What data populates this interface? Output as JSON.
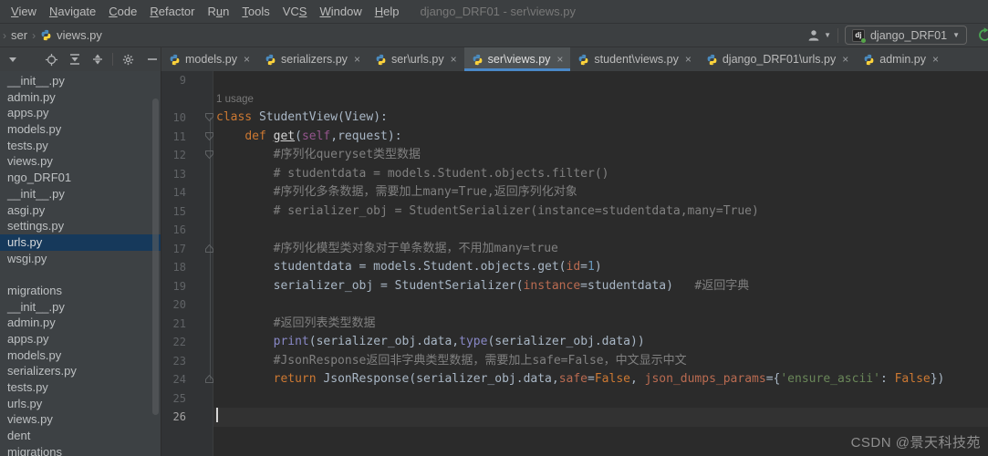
{
  "window": {
    "title": "django_DRF01 - ser\\views.py"
  },
  "menu": {
    "items": [
      {
        "label": "View",
        "u": 0
      },
      {
        "label": "Navigate",
        "u": 0
      },
      {
        "label": "Code",
        "u": 0
      },
      {
        "label": "Refactor",
        "u": 0
      },
      {
        "label": "Run",
        "u": 1
      },
      {
        "label": "Tools",
        "u": 0
      },
      {
        "label": "VCS",
        "u": 2
      },
      {
        "label": "Window",
        "u": 0
      },
      {
        "label": "Help",
        "u": 0
      }
    ]
  },
  "breadcrumb": {
    "items": [
      "ser",
      "views.py"
    ]
  },
  "header_right": {
    "run_config_label": "django_DRF01",
    "dj_abbrev": "dj"
  },
  "icons": {
    "chevron": "›",
    "dropdown": "▼",
    "close": "×",
    "minus": "—"
  },
  "project_panel": {
    "tools": [
      "view-options-dropdown",
      "locate-file",
      "expand-all",
      "collapse-all",
      "separator",
      "settings-gear",
      "hide-panel"
    ],
    "items": [
      "__init__.py",
      "admin.py",
      "apps.py",
      "models.py",
      "tests.py",
      "views.py",
      "ngo_DRF01",
      "__init__.py",
      "asgi.py",
      "settings.py",
      "urls.py",
      "wsgi.py",
      "",
      "migrations",
      "__init__.py",
      "admin.py",
      "apps.py",
      "models.py",
      "serializers.py",
      "tests.py",
      "urls.py",
      "views.py",
      "dent",
      "migrations"
    ],
    "selected_index": 10
  },
  "tabs": [
    {
      "label": "models.py"
    },
    {
      "label": "serializers.py"
    },
    {
      "label": "ser\\urls.py"
    },
    {
      "label": "ser\\views.py",
      "active": true
    },
    {
      "label": "student\\views.py"
    },
    {
      "label": "django_DRF01\\urls.py"
    },
    {
      "label": "admin.py"
    }
  ],
  "editor": {
    "rows": [
      {
        "num": "9",
        "segs": []
      },
      {
        "inlay": "1 usage"
      },
      {
        "num": "10",
        "fold": "down",
        "segs": [
          [
            "kw",
            "class"
          ],
          [
            "pl",
            " StudentView(View):"
          ]
        ]
      },
      {
        "num": "11",
        "fold": "down",
        "segs": [
          [
            "pl",
            "    "
          ],
          [
            "kw",
            "def"
          ],
          [
            "pl",
            " "
          ],
          [
            "fn",
            "get"
          ],
          [
            "pl",
            "("
          ],
          [
            "self",
            "self"
          ],
          [
            "pl",
            ",request):"
          ]
        ]
      },
      {
        "num": "12",
        "fold": "down",
        "segs": [
          [
            "cm",
            "        #序列化queryset类型数据"
          ]
        ]
      },
      {
        "num": "13",
        "segs": [
          [
            "cm",
            "        # studentdata = models.Student.objects.filter()"
          ]
        ]
      },
      {
        "num": "14",
        "segs": [
          [
            "cm",
            "        #序列化多条数据，需要加上many=True,返回序列化对象"
          ]
        ]
      },
      {
        "num": "15",
        "segs": [
          [
            "cm",
            "        # serializer_obj = StudentSerializer(instance=studentdata,many=True)"
          ]
        ]
      },
      {
        "num": "16",
        "segs": []
      },
      {
        "num": "17",
        "fold": "up",
        "segs": [
          [
            "cm",
            "        #序列化模型类对象对于单条数据，不用加many=true"
          ]
        ]
      },
      {
        "num": "18",
        "segs": [
          [
            "pl",
            "        studentdata = models.Student.objects.get("
          ],
          [
            "ka",
            "id"
          ],
          [
            "pl",
            "="
          ],
          [
            "nu",
            "1"
          ],
          [
            "pl",
            ")"
          ]
        ]
      },
      {
        "num": "19",
        "segs": [
          [
            "pl",
            "        serializer_obj = StudentSerializer("
          ],
          [
            "ka",
            "instance"
          ],
          [
            "pl",
            "=studentdata)   "
          ],
          [
            "cm",
            "#返回字典"
          ]
        ]
      },
      {
        "num": "20",
        "segs": []
      },
      {
        "num": "21",
        "segs": [
          [
            "cm",
            "        #返回列表类型数据"
          ]
        ]
      },
      {
        "num": "22",
        "segs": [
          [
            "pl",
            "        "
          ],
          [
            "bi",
            "print"
          ],
          [
            "pl",
            "(serializer_obj.data,"
          ],
          [
            "bi",
            "type"
          ],
          [
            "pl",
            "(serializer_obj.data))"
          ]
        ]
      },
      {
        "num": "23",
        "segs": [
          [
            "cm",
            "        #JsonResponse返回非字典类型数据，需要加上safe=False，中文显示中文"
          ]
        ]
      },
      {
        "num": "24",
        "fold": "up",
        "segs": [
          [
            "pl",
            "        "
          ],
          [
            "kw",
            "return"
          ],
          [
            "pl",
            " JsonResponse(serializer_obj.data,"
          ],
          [
            "ka",
            "safe"
          ],
          [
            "pl",
            "="
          ],
          [
            "kw",
            "False"
          ],
          [
            "pl",
            ", "
          ],
          [
            "ka",
            "json_dumps_params"
          ],
          [
            "pl",
            "={"
          ],
          [
            "st",
            "'ensure_ascii'"
          ],
          [
            "pl",
            ": "
          ],
          [
            "kw",
            "False"
          ],
          [
            "pl",
            "})"
          ]
        ]
      },
      {
        "num": "25",
        "segs": []
      },
      {
        "num": "26",
        "cursor": true,
        "segs": []
      }
    ]
  },
  "watermark": "CSDN @景天科技苑",
  "colors": {
    "panel_bg": "#3C3F41",
    "editor_bg": "#2B2B2B",
    "gutter_bg": "#313335",
    "selection_bg": "#16395B",
    "active_tab_underline": "#4A88C7",
    "keyword": "#CC7832",
    "named_arg": "#BA6B51",
    "string": "#6A8759",
    "number": "#6897BB",
    "builtin": "#8888C6",
    "comment": "#808080",
    "self": "#94558D",
    "default_text": "#A9B7C6",
    "line_number": "#606366",
    "run_green": "#4AA653",
    "python_blue": "#4B8BBE",
    "python_yellow": "#FFD43B"
  }
}
